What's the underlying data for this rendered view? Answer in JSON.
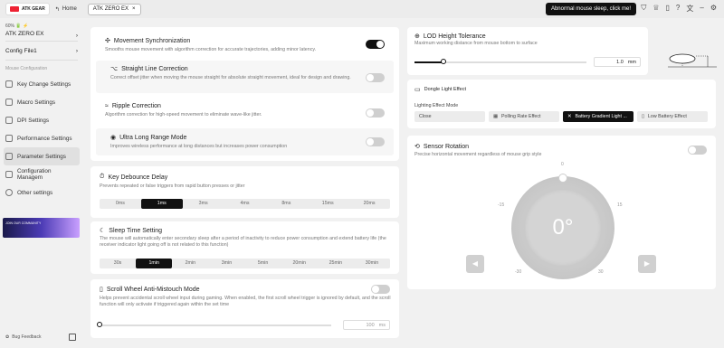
{
  "topbar": {
    "logo_text": "ATK GEAR",
    "home_label": "Home",
    "tab_label": "ATK ZERO EX",
    "alert_text": "Abnormal mouse sleep, click me!",
    "icons": [
      "shirt-icon",
      "crown-icon",
      "document-icon",
      "question-icon",
      "translate-icon",
      "minus-icon",
      "settings-icon"
    ]
  },
  "sidebar": {
    "battery": "60% 🔋 ⚡",
    "device_name": "ATK ZERO EX",
    "config_label": "Config File1",
    "section_label": "Mouse Configuration",
    "items": [
      {
        "label": "Key Change Settings"
      },
      {
        "label": "Macro Settings"
      },
      {
        "label": "DPI Settings"
      },
      {
        "label": "Performance Settings"
      },
      {
        "label": "Parameter Settings"
      },
      {
        "label": "Configuration Managem"
      },
      {
        "label": "Other settings"
      }
    ],
    "promo_text": "JOIN OUR COMMUNITY",
    "bug_feedback": "Bug Feedback"
  },
  "motion": {
    "sync_title": "Movement Synchronization",
    "sync_desc": "Smooths mouse movement with algorithm correction for accurate trajectories, adding minor latency.",
    "sync_on": true,
    "straight_title": "Straight Line Correction",
    "straight_desc": "Correct offset jitter when moving the mouse straight for absolute straight movement, ideal for design and drawing.",
    "straight_on": false,
    "ripple_title": "Ripple Correction",
    "ripple_desc": "Algorithm correction for high-speed movement to eliminate wave-like jitter.",
    "ripple_on": false,
    "ulr_title": "Ultra Long Range Mode",
    "ulr_desc": "Improves wireless performance at long distances but increases power consumption",
    "ulr_on": false
  },
  "debounce": {
    "title": "Key Debounce Delay",
    "desc": "Prevents repeated or false triggers from rapid button presses or jitter",
    "options": [
      "0ms",
      "1ms",
      "3ms",
      "4ms",
      "8ms",
      "15ms",
      "20ms"
    ],
    "selected": "1ms"
  },
  "sleep": {
    "title": "Sleep Time Setting",
    "desc": "The mouse will automatically enter secondary sleep after a period of inactivity to reduce power consumption and extend battery life (the receiver indicator light going off is not related to this function)",
    "options": [
      "30s",
      "1min",
      "2min",
      "3min",
      "5min",
      "20min",
      "25min",
      "30min"
    ],
    "selected": "1min"
  },
  "scroll": {
    "title": "Scroll Wheel Anti-Mistouch Mode",
    "desc": "Helps prevent accidental scroll wheel input during gaming. When enabled, the first scroll wheel trigger is ignored by default, and the scroll function will only activate if triggered again within the set time",
    "on": false,
    "value": "100",
    "unit": "ms",
    "fraction": 0.0
  },
  "lod": {
    "title": "LOD Height Tolerance",
    "desc": "Maximum working distance from mouse bottom to surface",
    "value": "1.0",
    "unit": "mm",
    "fraction": 0.17
  },
  "dongle": {
    "title": "Dongle Light Effect",
    "mode_label": "Lighting Effect Mode",
    "options": [
      "Close",
      "Polling Rate Effect",
      "Battery Gradient Light ...",
      "Low Battery Effect"
    ],
    "selected": "Battery Gradient Light ..."
  },
  "sensor": {
    "title": "Sensor Rotation",
    "desc": "Precise horizontal movement regardless of mouse grip style",
    "on": false,
    "value": "0°",
    "ticks": {
      "top": "0",
      "left15": "-15",
      "right15": "15",
      "left30": "-30",
      "right30": "30"
    }
  }
}
